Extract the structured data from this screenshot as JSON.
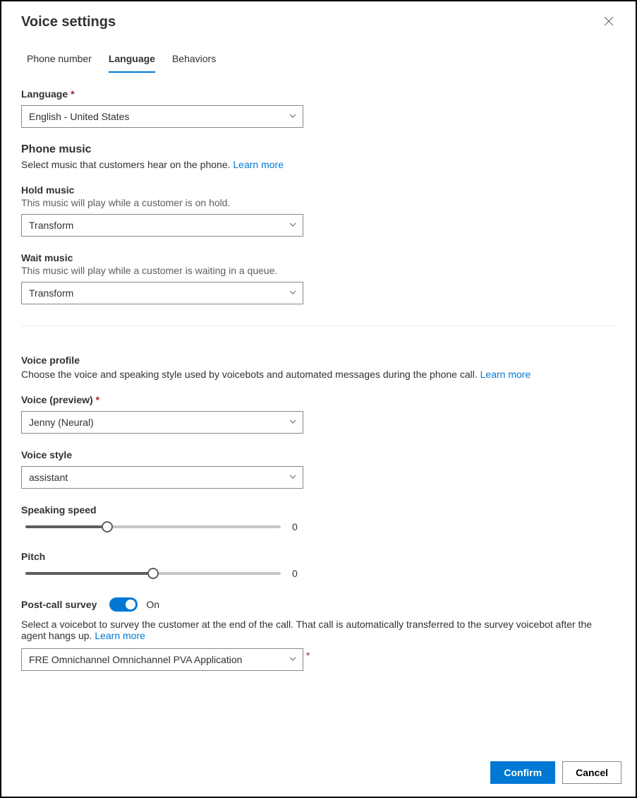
{
  "header": {
    "title": "Voice settings"
  },
  "tabs": {
    "phone_number": "Phone number",
    "language": "Language",
    "behaviors": "Behaviors"
  },
  "language": {
    "label": "Language",
    "value": "English - United States"
  },
  "phone_music": {
    "heading": "Phone music",
    "desc": "Select music that customers hear on the phone. ",
    "learn_more": "Learn more"
  },
  "hold_music": {
    "label": "Hold music",
    "desc": "This music will play while a customer is on hold.",
    "value": "Transform"
  },
  "wait_music": {
    "label": "Wait music",
    "desc": "This music will play while a customer is waiting in a queue.",
    "value": "Transform"
  },
  "voice_profile": {
    "heading": "Voice profile",
    "desc": "Choose the voice and speaking style used by voicebots and automated messages during the phone call. ",
    "learn_more": "Learn more"
  },
  "voice": {
    "label": "Voice (preview)",
    "value": "Jenny (Neural)"
  },
  "voice_style": {
    "label": "Voice style",
    "value": "assistant"
  },
  "speaking_speed": {
    "label": "Speaking speed",
    "value": "0",
    "percent": 32
  },
  "pitch": {
    "label": "Pitch",
    "value": "0",
    "percent": 50
  },
  "post_call": {
    "label": "Post-call survey",
    "state": "On",
    "desc": "Select a voicebot to survey the customer at the end of the call. That call is automatically transferred to the survey voicebot after the agent hangs up. ",
    "learn_more": "Learn more",
    "value": "FRE Omnichannel Omnichannel PVA Application"
  },
  "footer": {
    "confirm": "Confirm",
    "cancel": "Cancel"
  }
}
